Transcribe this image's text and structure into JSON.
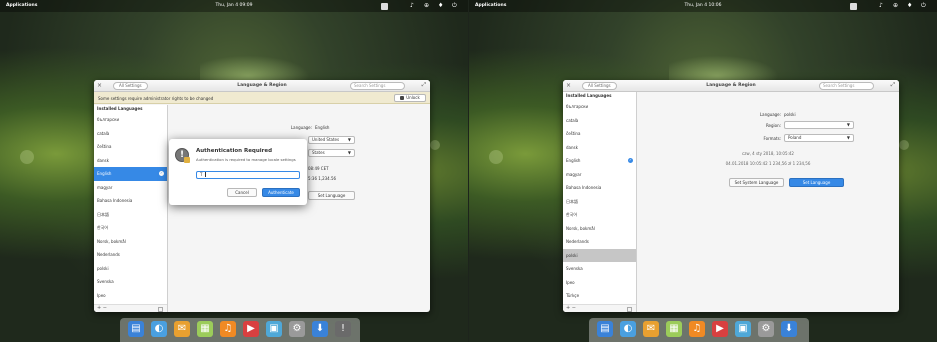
{
  "left": {
    "panel": {
      "apps": "Applications",
      "clock": "Thu, Jan 4 09:09"
    },
    "window": {
      "back": "All Settings",
      "title": "Language & Region",
      "search_placeholder": "Search Settings",
      "infobar": {
        "message": "Some settings require administrator rights to be changed",
        "unlock": "Unlock"
      },
      "sidebar": {
        "header": "Installed Languages",
        "items": [
          "български",
          "català",
          "čeština",
          "dansk",
          "English",
          "magyar",
          "Bahasa Indonesia",
          "日本語",
          "한국어",
          "Norsk, bokmål",
          "Nederlands",
          "polski",
          "Svenska",
          "Ірео"
        ],
        "selected_index": 4,
        "footer": "+ −"
      },
      "pane": {
        "language_label": "Language:",
        "language_value": "English",
        "region_value": "United States",
        "formats_value": "States",
        "time_partial": "08:49 CET",
        "number_partial": "5:36 1,234.56",
        "set_language": "Set Language"
      }
    },
    "dialog": {
      "title": "Authentication Required",
      "subtitle": "Authentication is required to manage locale settings",
      "password_prefix": "T",
      "cancel": "Cancel",
      "authenticate": "Authenticate"
    }
  },
  "right": {
    "panel": {
      "apps": "Applications",
      "clock": "Thu, Jan 4 10:06"
    },
    "window": {
      "back": "All Settings",
      "title": "Language & Region",
      "search_placeholder": "Search Settings",
      "sidebar": {
        "header": "Installed Languages",
        "items": [
          "български",
          "català",
          "čeština",
          "dansk",
          "English",
          "magyar",
          "Bahasa Indonesia",
          "日本語",
          "한국어",
          "Norsk, bokmål",
          "Nederlands",
          "polski",
          "Svenska",
          "Ірео",
          "Türkçe"
        ],
        "checked_index": 4,
        "highlight_index": 11,
        "footer": "+ −"
      },
      "pane": {
        "language_label": "Language:",
        "language_value": "polski",
        "region_label": "Region:",
        "region_value": "",
        "formats_label": "Formats:",
        "formats_value": "Poland",
        "date_line": "czw, 4 sty 2018, 10:05:42",
        "number_line": "04.01.2018 10:05:42 1 234,56 zł 1 234,56",
        "set_system": "Set System Language",
        "set_language": "Set Language"
      }
    }
  },
  "dock": {
    "icons": [
      "files-icon",
      "browser-icon",
      "mail-icon",
      "calendar-icon",
      "music-icon",
      "videos-icon",
      "photos-icon",
      "system-settings-icon",
      "appcenter-icon",
      "auth-dialog-icon"
    ],
    "colors": [
      "#3a82d8",
      "#4aa0e0",
      "#e8a030",
      "#9ccc5a",
      "#f08a24",
      "#d84040",
      "#4fa8d8",
      "#9a9a9a",
      "#3a82d8",
      "#6a6a6a"
    ]
  }
}
